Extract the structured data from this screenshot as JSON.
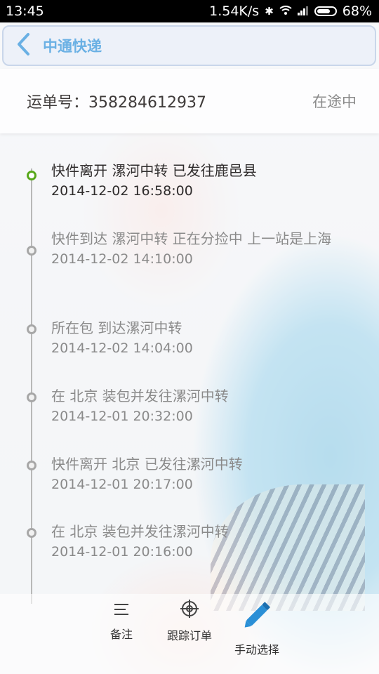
{
  "status_bar": {
    "time": "13:45",
    "network_speed": "1.54K/s",
    "battery": "68%",
    "icons": [
      "bluetooth-icon",
      "wifi-icon",
      "signal-icon",
      "battery-icon"
    ]
  },
  "header": {
    "title": "中通快递",
    "back_icon": "chevron-left-icon"
  },
  "waybill": {
    "label": "运单号：",
    "number": "358284612937",
    "status": "在途中"
  },
  "timeline": [
    {
      "text": "快件离开 漯河中转 已发往鹿邑县",
      "time": "2014-12-02 16:58:00"
    },
    {
      "text": "快件到达 漯河中转 正在分捡中 上一站是上海",
      "time": "2014-12-02 14:10:00"
    },
    {
      "text": "所在包 到达漯河中转",
      "time": "2014-12-02 14:04:00"
    },
    {
      "text": "在 北京 装包并发往漯河中转",
      "time": "2014-12-01 20:32:00"
    },
    {
      "text": "快件离开 北京 已发往漯河中转",
      "time": "2014-12-01 20:17:00"
    },
    {
      "text": "在 北京 装包并发往漯河中转",
      "time": "2014-12-01 20:16:00"
    }
  ],
  "bottom_bar": {
    "note": "备注",
    "track": "跟踪订单",
    "manual": "手动选择"
  },
  "colors": {
    "accent": "#6ab0e4",
    "current_dot": "#58a81b",
    "pen": "#2a8fd6"
  }
}
